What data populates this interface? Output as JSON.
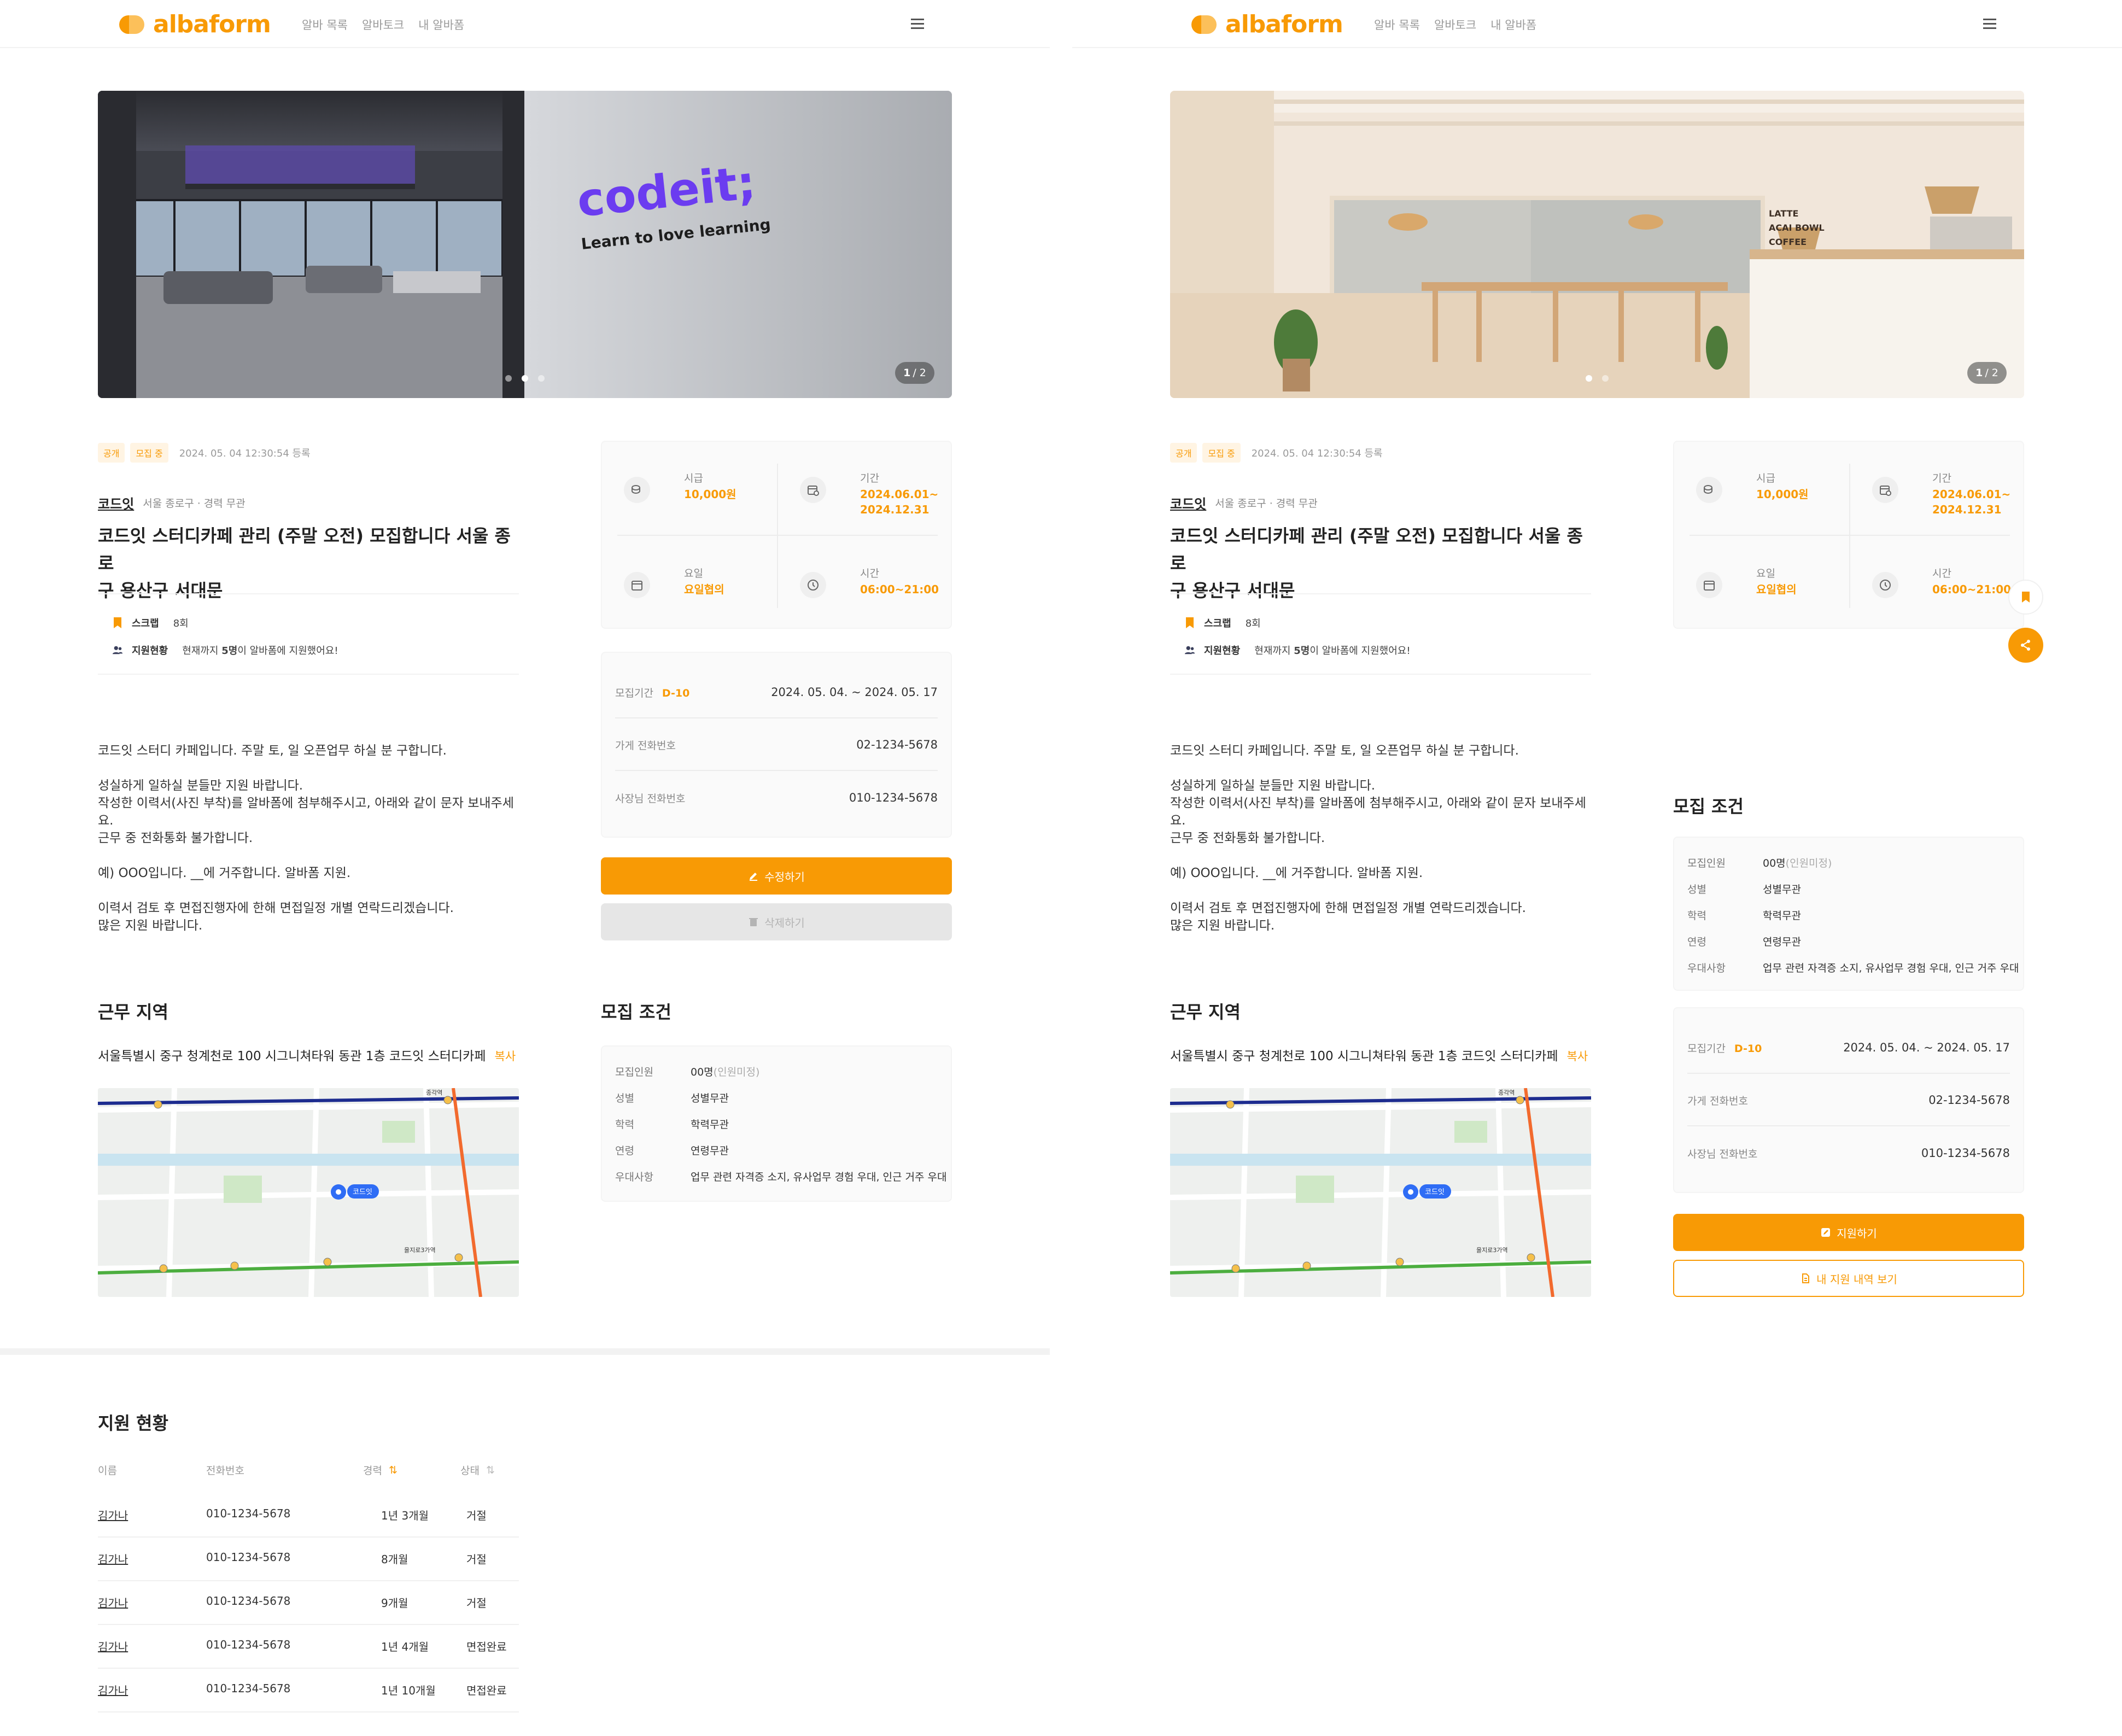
{
  "brand": {
    "name": "albaform",
    "color": "#F89A05"
  },
  "nav": [
    "알바 목록",
    "알바토크",
    "내 알바폼"
  ],
  "left": {
    "carousel": {
      "current": "1",
      "total": "/ 2"
    },
    "tags": [
      "공개",
      "모집 중"
    ],
    "posted": "2024. 05. 04  12:30:54 등록",
    "company": "코드잇",
    "location": "서울 종로구 · 경력 무관",
    "title_line1": "코드잇 스터디카페 관리 (주말 오전) 모집합니다 서울 종    로",
    "title_line2": "구 용산구 서대문",
    "scrap": {
      "label": "스크랩",
      "value": "8회"
    },
    "applicants": {
      "label": "지원현황",
      "prefix": "현재까지 ",
      "count": "5명",
      "suffix": "이 알바폼에 지원했어요!"
    },
    "description": [
      "코드잇 스터디 카페입니다. 주말 토, 일 오픈업무 하실 분 구합니다.",
      "",
      "성실하게 일하실 분들만 지원 바랍니다.",
      "작성한 이력서(사진 부착)를 알바폼에 첨부해주시고, 아래와 같이 문자 보내주세요.",
      "근무 중 전화통화 불가합니다.",
      "",
      "예) OOO입니다. __에 거주합니다. 알바폼 지원.",
      "",
      "이력서 검토 후 면접진행자에 한해 면접일정 개별 연락드리겠습니다.",
      "많은 지원 바랍니다."
    ],
    "info": {
      "wage_label": "시급",
      "wage": "10,000원",
      "period_label": "기간",
      "period_1": "2024.06.01~",
      "period_2": "2024.12.31",
      "days_label": "요일",
      "days": "요일협의",
      "time_label": "시간",
      "time": "06:00~21:00"
    },
    "contact": {
      "recruit_label": "모집기간",
      "dday": "D-10",
      "recruit_range": "2024. 05. 04. ~ 2024. 05. 17",
      "store_phone_label": "가게 전화번호",
      "store_phone": "02-1234-5678",
      "owner_phone_label": "사장님 전화번호",
      "owner_phone": "010-1234-5678"
    },
    "edit_button": "수정하기",
    "delete_button": "삭제하기",
    "work_area_title": "근무 지역",
    "address": "서울특별시 중구 청계천로 100 시그니쳐타워 동관 1층 코드잇 스터디카페",
    "copy": "복사",
    "conditions_title": "모집 조건",
    "conditions": [
      {
        "k": "모집인원",
        "v": "00명",
        "sub": " (인원미정)"
      },
      {
        "k": "성별",
        "v": "성별무관",
        "sub": ""
      },
      {
        "k": "학력",
        "v": "학력무관",
        "sub": ""
      },
      {
        "k": "연령",
        "v": "연령무관",
        "sub": ""
      },
      {
        "k": "우대사항",
        "v": "업무 관련 자격증 소지, 유사업무 경험 우대, 인근 거주 우대",
        "sub": ""
      }
    ],
    "applications_title": "지원 현황",
    "table": {
      "headers": {
        "name": "이름",
        "phone": "전화번호",
        "exp": "경력",
        "status": "상태"
      },
      "rows": [
        {
          "name": "김가나",
          "phone": "010-1234-5678",
          "exp": "1년 3개월",
          "status": "거절"
        },
        {
          "name": "김가나",
          "phone": "010-1234-5678",
          "exp": "8개월",
          "status": "거절"
        },
        {
          "name": "김가나",
          "phone": "010-1234-5678",
          "exp": "9개월",
          "status": "거절"
        },
        {
          "name": "김가나",
          "phone": "010-1234-5678",
          "exp": "1년 4개월",
          "status": "면접완료"
        },
        {
          "name": "김가나",
          "phone": "010-1234-5678",
          "exp": "1년 10개월",
          "status": "면접완료"
        }
      ]
    },
    "hero_sign": "codeit;",
    "hero_tagline": "Learn to love learning"
  },
  "right": {
    "carousel": {
      "current": "1",
      "total": "/ 2"
    },
    "apply_button": "지원하기",
    "history_button": "내 지원 내역 보기",
    "menu_board": [
      "LATTE",
      "ACAI BOWL",
      "COFFEE"
    ]
  },
  "map_labels": {
    "pin": "코드잇",
    "station1": "을지로3가역",
    "station2": "종각역"
  }
}
